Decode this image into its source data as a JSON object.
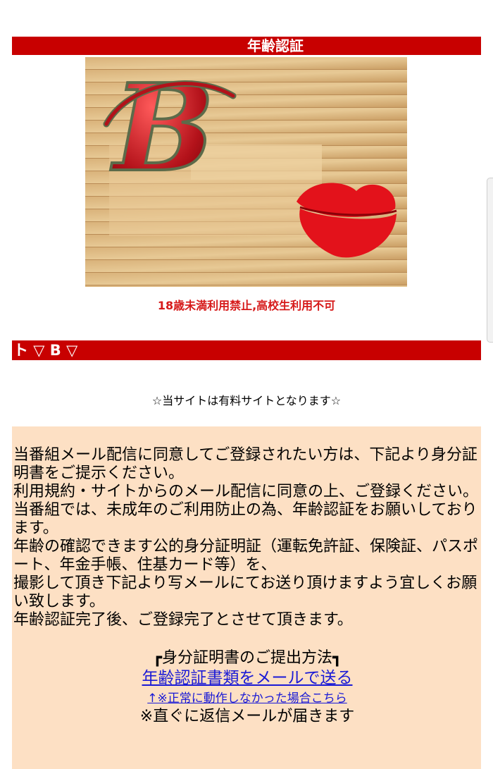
{
  "header": {
    "title": "年齢認証"
  },
  "logo": {
    "letter": "B"
  },
  "warning": "18歳未満利用禁止,高校生利用不可",
  "section": {
    "title": "ト ▽ B ▽"
  },
  "notice": "☆当サイトは有料サイトとなります☆",
  "body_lines": [
    "当番組メール配信に同意してご登録されたい方は、下記より身分証明書をご提示ください。",
    "利用規約・サイトからのメール配信に同意の上、ご登録ください。",
    "当番組では、未成年のご利用防止の為、年齢認証をお願いしております。",
    "年齢の確認できます公的身分証明証（運転免許証、保険証、パスポート、年金手帳、住基カード等）を、",
    "撮影して頂き下記より写メールにてお送り頂けますよう宜しくお願い致します。",
    "年齢認証完了後、ご登録完了とさせて頂きます。"
  ],
  "howto_title": "┏身分証明書のご提出方法┓",
  "mail_link": "年齢認証書類をメールで送る",
  "alt_link": "↑※正常に動作しなかった場合こちら",
  "reply_note": "※直ぐに返信メールが届きます",
  "colors": {
    "bar": "#c80000",
    "panel": "#fde0c4",
    "link": "#1a1ad6",
    "warning": "#d61a1a"
  }
}
